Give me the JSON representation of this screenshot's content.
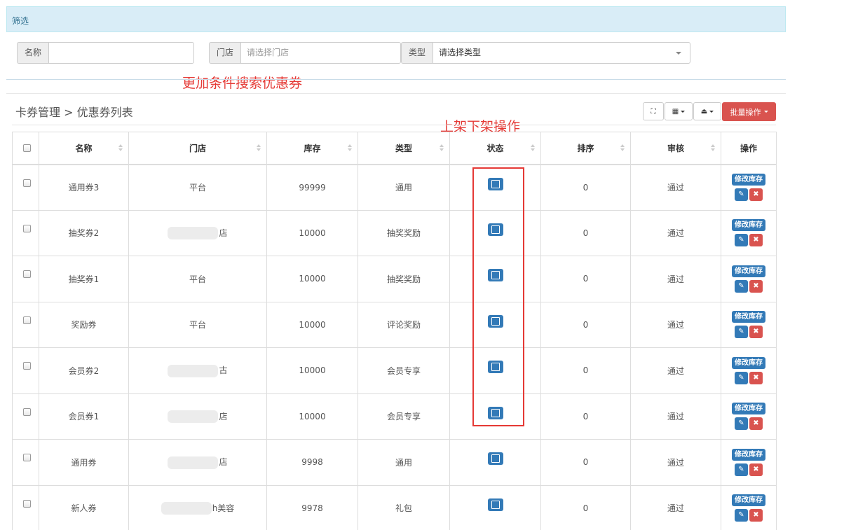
{
  "filter_bar": {
    "title": "筛选"
  },
  "filters": {
    "name_label": "名称",
    "name_value": "",
    "store_label": "门店",
    "store_placeholder": "请选择门店",
    "type_label": "类型",
    "type_selected": "请选择类型"
  },
  "annotations": {
    "search_note": "更加条件搜索优惠券",
    "shelf_note": "上架下架操作"
  },
  "page": {
    "breadcrumb": "卡券管理 > 优惠券列表"
  },
  "toolbar": {
    "batch_label": "批量操作"
  },
  "table": {
    "headers": [
      "名称",
      "门店",
      "库存",
      "类型",
      "状态",
      "排序",
      "审核",
      "操作"
    ],
    "edit_stock_label": "修改库存",
    "rows": [
      {
        "name": "通用券3",
        "store": "平台",
        "stock": "99999",
        "type": "通用",
        "sort": "0",
        "audit": "通过"
      },
      {
        "name": "抽奖券2",
        "store": "店",
        "stock": "10000",
        "type": "抽奖奖励",
        "sort": "0",
        "audit": "通过"
      },
      {
        "name": "抽奖券1",
        "store": "平台",
        "stock": "10000",
        "type": "抽奖奖励",
        "sort": "0",
        "audit": "通过"
      },
      {
        "name": "奖励券",
        "store": "平台",
        "stock": "10000",
        "type": "评论奖励",
        "sort": "0",
        "audit": "通过"
      },
      {
        "name": "会员券2",
        "store": "古",
        "stock": "10000",
        "type": "会员专享",
        "sort": "0",
        "audit": "通过"
      },
      {
        "name": "会员券1",
        "store": "店",
        "stock": "10000",
        "type": "会员专享",
        "sort": "0",
        "audit": "通过"
      },
      {
        "name": "通用券",
        "store": "店",
        "stock": "9998",
        "type": "通用",
        "sort": "0",
        "audit": "通过"
      },
      {
        "name": "新人券",
        "store": "h美容",
        "stock": "9978",
        "type": "礼包",
        "sort": "0",
        "audit": "通过"
      }
    ]
  },
  "colors": {
    "primary": "#337ab7",
    "danger": "#d9534f",
    "annotation": "#e53935",
    "info_bg": "#d9edf7"
  }
}
